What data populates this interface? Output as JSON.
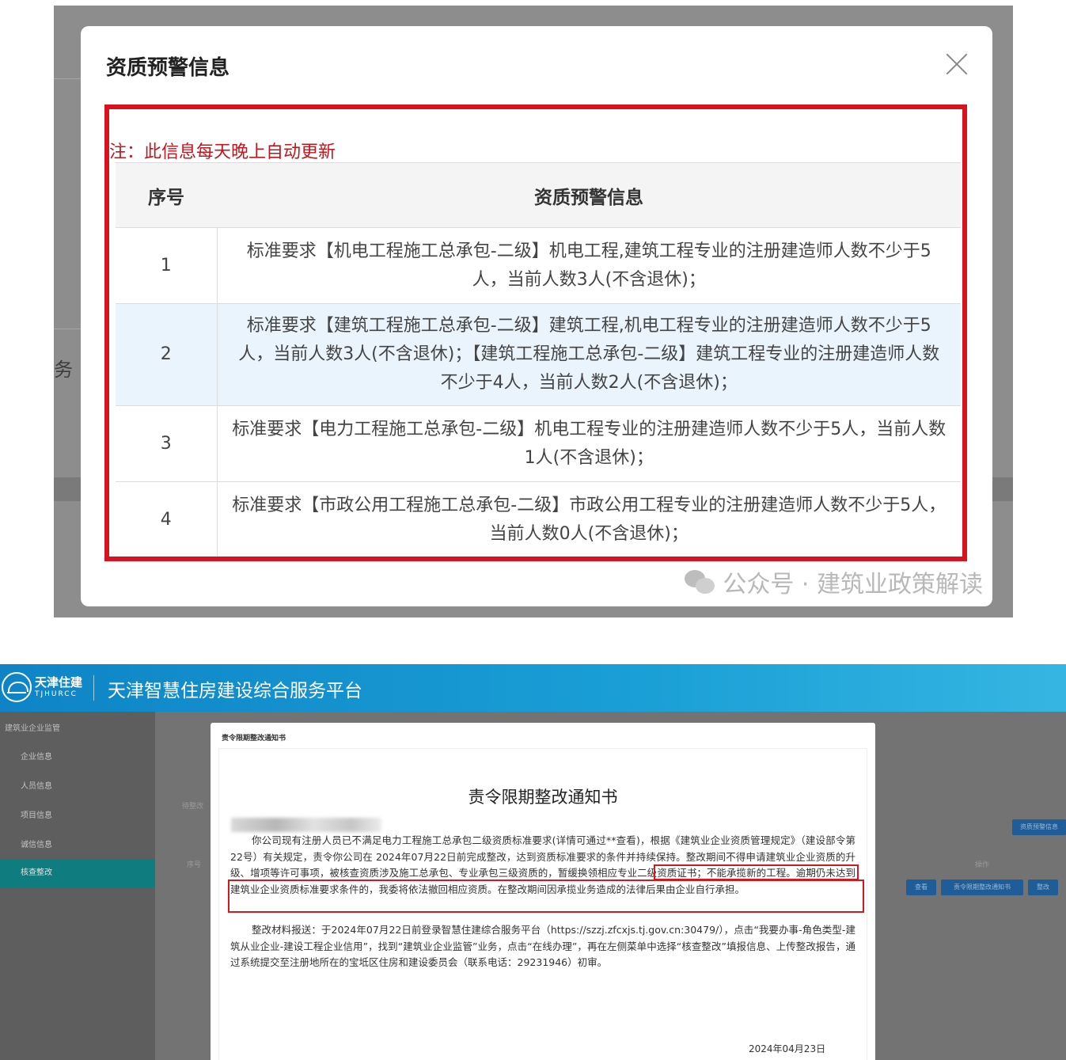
{
  "dialog": {
    "title": "资质预警信息",
    "note": "注：此信息每天晚上自动更新",
    "columns": [
      "序号",
      "资质预警信息"
    ],
    "rows": [
      {
        "index": "1",
        "text": "标准要求【机电工程施工总承包-二级】机电工程,建筑工程专业的注册建造师人数不少于5人，当前人数3人(不含退休)；"
      },
      {
        "index": "2",
        "text": "标准要求【建筑工程施工总承包-二级】建筑工程,机电工程专业的注册建造师人数不少于5人，当前人数3人(不含退休)；【建筑工程施工总承包-二级】建筑工程专业的注册建造师人数不少于4人，当前人数2人(不含退休)；"
      },
      {
        "index": "3",
        "text": "标准要求【电力工程施工总承包-二级】机电工程专业的注册建造师人数不少于5人，当前人数1人(不含退休)；"
      },
      {
        "index": "4",
        "text": "标准要求【市政公用工程施工总承包-二级】市政公用工程专业的注册建造师人数不少于5人，当前人数0人(不含退休)；"
      }
    ],
    "background_fragment": "务",
    "watermark": "公众号 · 建筑业政策解读"
  },
  "platform": {
    "logo_cn": "天津住建",
    "logo_en": "TJHURCC",
    "title": "天津智慧住房建设综合服务平台"
  },
  "sidebar": {
    "group": "建筑业企业监管",
    "items": [
      "企业信息",
      "人员信息",
      "项目信息",
      "诚信信息",
      "核查整改"
    ],
    "active_index": 4
  },
  "background_page": {
    "tab": "待整改",
    "col_index": "序号",
    "col_action": "操作",
    "buttons": [
      "查看",
      "责令限期整改通知书",
      "整改"
    ],
    "top_right_button": "资质预警信息"
  },
  "notice": {
    "header": "责令限期整改通知书",
    "title": "责令限期整改通知书",
    "para1": "你公司现有注册人员已不满足电力工程施工总承包二级资质标准要求(详情可通过**查看)，根据《建筑业企业资质管理规定》（建设部令第22号）有关规定，责令你公司在 2024年07月22日前完成整改，达到资质标准要求的条件并持续保持。整改期间不得申请建筑业企业资质的升级、增项等许可事项，被核查资质涉及施工总承包、专业承包三级资质的，暂缓换领相应专业二级资质证书；不能承揽新的工程。逾期仍未达到建筑业企业资质标准要求条件的，我委将依法撤回相应资质。在整改期间因承揽业务造成的法律后果由企业自行承担。",
    "para2": "整改材料报送：于2024年07月22日前登录智慧住建综合服务平台（https://szzj.zfcxjs.tj.gov.cn:30479/），点击“我要办事-角色类型-建筑从业企业-建设工程企业信用”，找到“建筑业企业监管”业务，点击“在线办理”，再在左侧菜单中选择“核查整改”填报信息、上传整改报告，通过系统提交至注册地所在的宝坻区住房和建设委员会（联系电话：29231946）初审。",
    "date": "2024年04月23日"
  },
  "colors": {
    "highlight_red": "#d8121e",
    "header_blue": "#1a9fd6",
    "sidebar_active": "#0f7c80"
  }
}
